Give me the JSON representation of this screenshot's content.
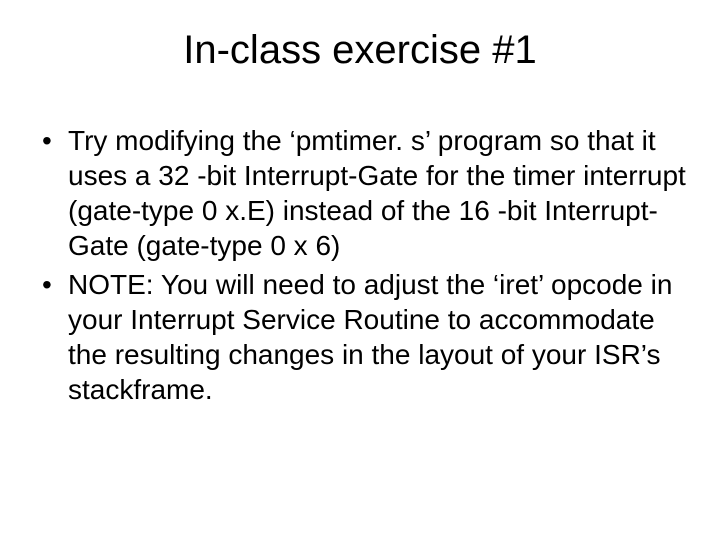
{
  "title": "In-class exercise #1",
  "bullets": [
    "Try modifying the ‘pmtimer. s’ program so that it uses a 32 -bit Interrupt-Gate for the timer interrupt (gate-type 0 x.E) instead of the 16 -bit Interrupt-Gate (gate-type 0 x 6)",
    "NOTE: You will need to adjust the ‘iret’ opcode in your Interrupt Service Routine to accommodate the resulting changes in the layout of your ISR’s stackframe."
  ]
}
